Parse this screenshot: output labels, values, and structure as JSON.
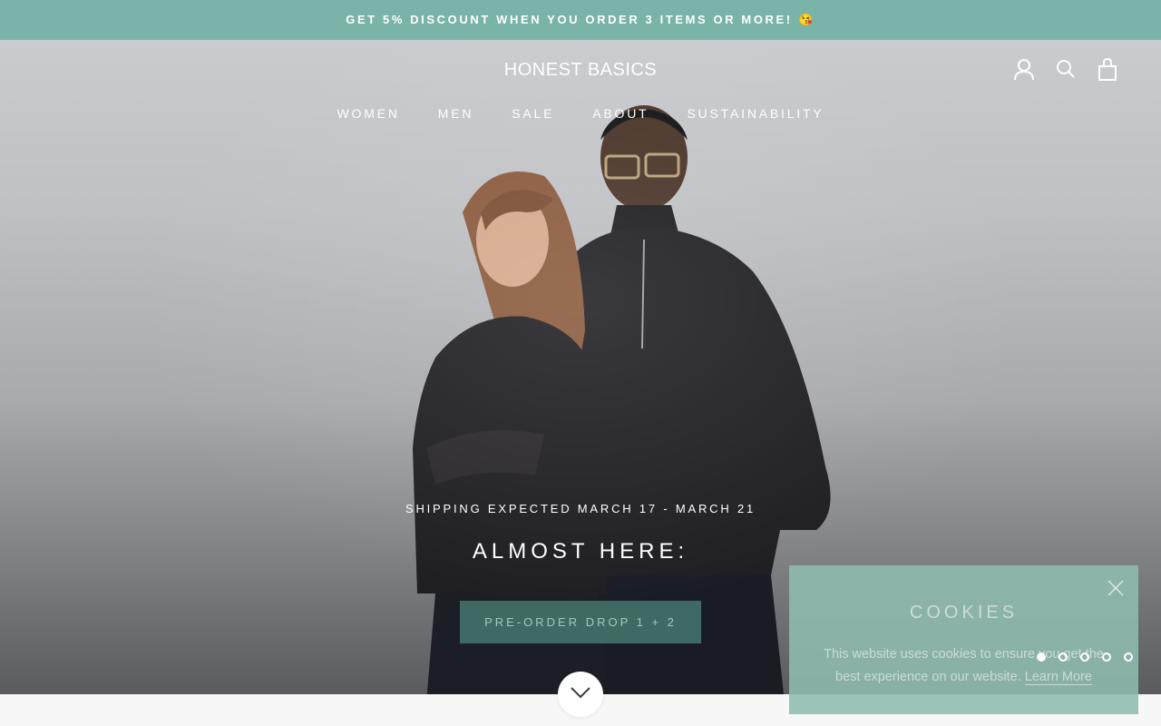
{
  "colors": {
    "announcement_bg": "#7ab3a8",
    "cookie_bg": "#8fbcb0",
    "cta_bg": "#3f6a63",
    "accent": "#9fc9c0"
  },
  "announcement": {
    "text": "GET 5% DISCOUNT WHEN YOU ORDER 3 ITEMS OR MORE! 😘"
  },
  "header": {
    "logo": "HONEST BASICS",
    "nav": [
      {
        "label": "WOMEN"
      },
      {
        "label": "MEN"
      },
      {
        "label": "SALE"
      },
      {
        "label": "ABOUT"
      },
      {
        "label": "SUSTAINABILITY"
      }
    ],
    "icons": [
      "account-icon",
      "search-icon",
      "cart-bag-icon"
    ]
  },
  "hero": {
    "subheading": "SHIPPING EXPECTED MARCH 17 - MARCH 21",
    "heading": "ALMOST HERE:",
    "cta_label": "PRE-ORDER DROP 1 + 2",
    "scroll_icon": "chevron-down-icon",
    "slides": {
      "count": 5,
      "active": 1
    }
  },
  "cookie_banner": {
    "title": "COOKIES",
    "text": "This website uses cookies to ensure you get the best experience on our website.",
    "link_label": "Learn More",
    "close_icon": "close-icon"
  }
}
